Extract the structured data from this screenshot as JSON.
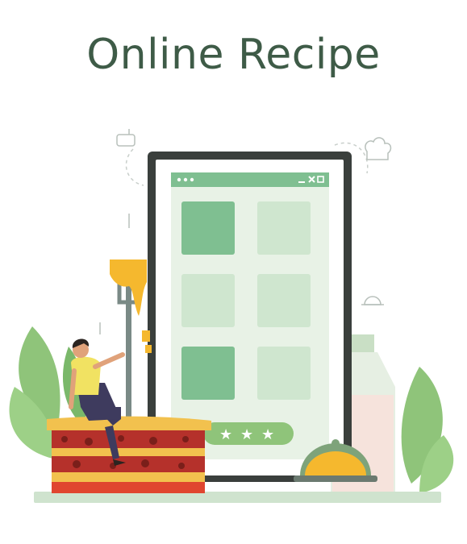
{
  "header": {
    "title": "Online Recipe"
  },
  "colors": {
    "title": "#3e5b47",
    "phone_frame": "#3a3f3c",
    "screen_bg": "#e8f2e6",
    "tile_dark": "#7fbf91",
    "tile_light": "#cfe6cf",
    "leaf": "#8fc47a",
    "lasagna_sauce": "#b5312b",
    "lasagna_pasta": "#f2c14e",
    "cheese": "#f5b82e",
    "cloche": "#7ea37a"
  },
  "icons": [
    "menu-dots-icon",
    "minimize-icon",
    "close-icon",
    "maximize-icon",
    "star-icon",
    "fork-icon",
    "cloche-icon",
    "bottle-icon",
    "chef-hat-icon",
    "whisk-icon"
  ],
  "rating": {
    "stars": 3
  }
}
